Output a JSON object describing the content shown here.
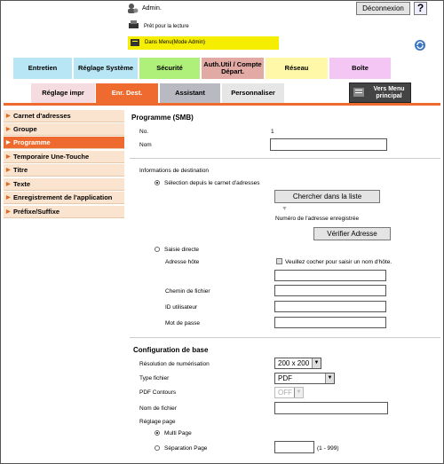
{
  "header": {
    "user": "Admin.",
    "logout": "Déconnexion",
    "help": "?",
    "status": "Prêt pour la lecture",
    "mode": "Dans Menu(Mode Admin)"
  },
  "tabs": [
    "Entretien",
    "Réglage Système",
    "Sécurité",
    "Auth.Util / Compte Départ.",
    "Réseau",
    "Boîte"
  ],
  "subtabs": [
    "Réglage impr",
    "Enr. Dest.",
    "Assistant",
    "Personnaliser"
  ],
  "menu_button": "Vers Menu principal",
  "sidebar": [
    "Carnet d'adresses",
    "Groupe",
    "Programme",
    "Temporaire Une-Touche",
    "Titre",
    "Texte",
    "Enregistrement de l'application",
    "Préfixe/Suffixe"
  ],
  "form": {
    "title": "Programme (SMB)",
    "no_label": "No.",
    "no_value": "1",
    "nom_label": "Nom",
    "dest_title": "Informations de destination",
    "radio_select": "Sélection depuis le carnet d'adresses",
    "search_btn": "Chercher dans la liste",
    "registered": "Numéro de l'adresse enregistrée",
    "verify_btn": "Vérifier Adresse",
    "radio_direct": "Saisie directe",
    "host_label": "Adresse hôte",
    "host_check": "Veuillez cocher pour saisir un nom d'hôte.",
    "path_label": "Chemin de fichier",
    "user_label": "ID utilisateur",
    "pass_label": "Mot de passe",
    "base_title": "Configuration de base",
    "res_label": "Résolution de numérisation",
    "res_value": "200 x 200",
    "type_label": "Type fichier",
    "type_value": "PDF",
    "contours_label": "PDF Contours",
    "contours_value": "OFF",
    "filename_label": "Nom de fichier",
    "page_label": "Réglage page",
    "multi": "Multi Page",
    "sep": "Séparation Page",
    "sep_range": "(1 - 999)"
  },
  "colors": {
    "accent": "#ee6a2e",
    "sidebar": "#fbe4cf",
    "mode_bar": "#f6ee00"
  }
}
